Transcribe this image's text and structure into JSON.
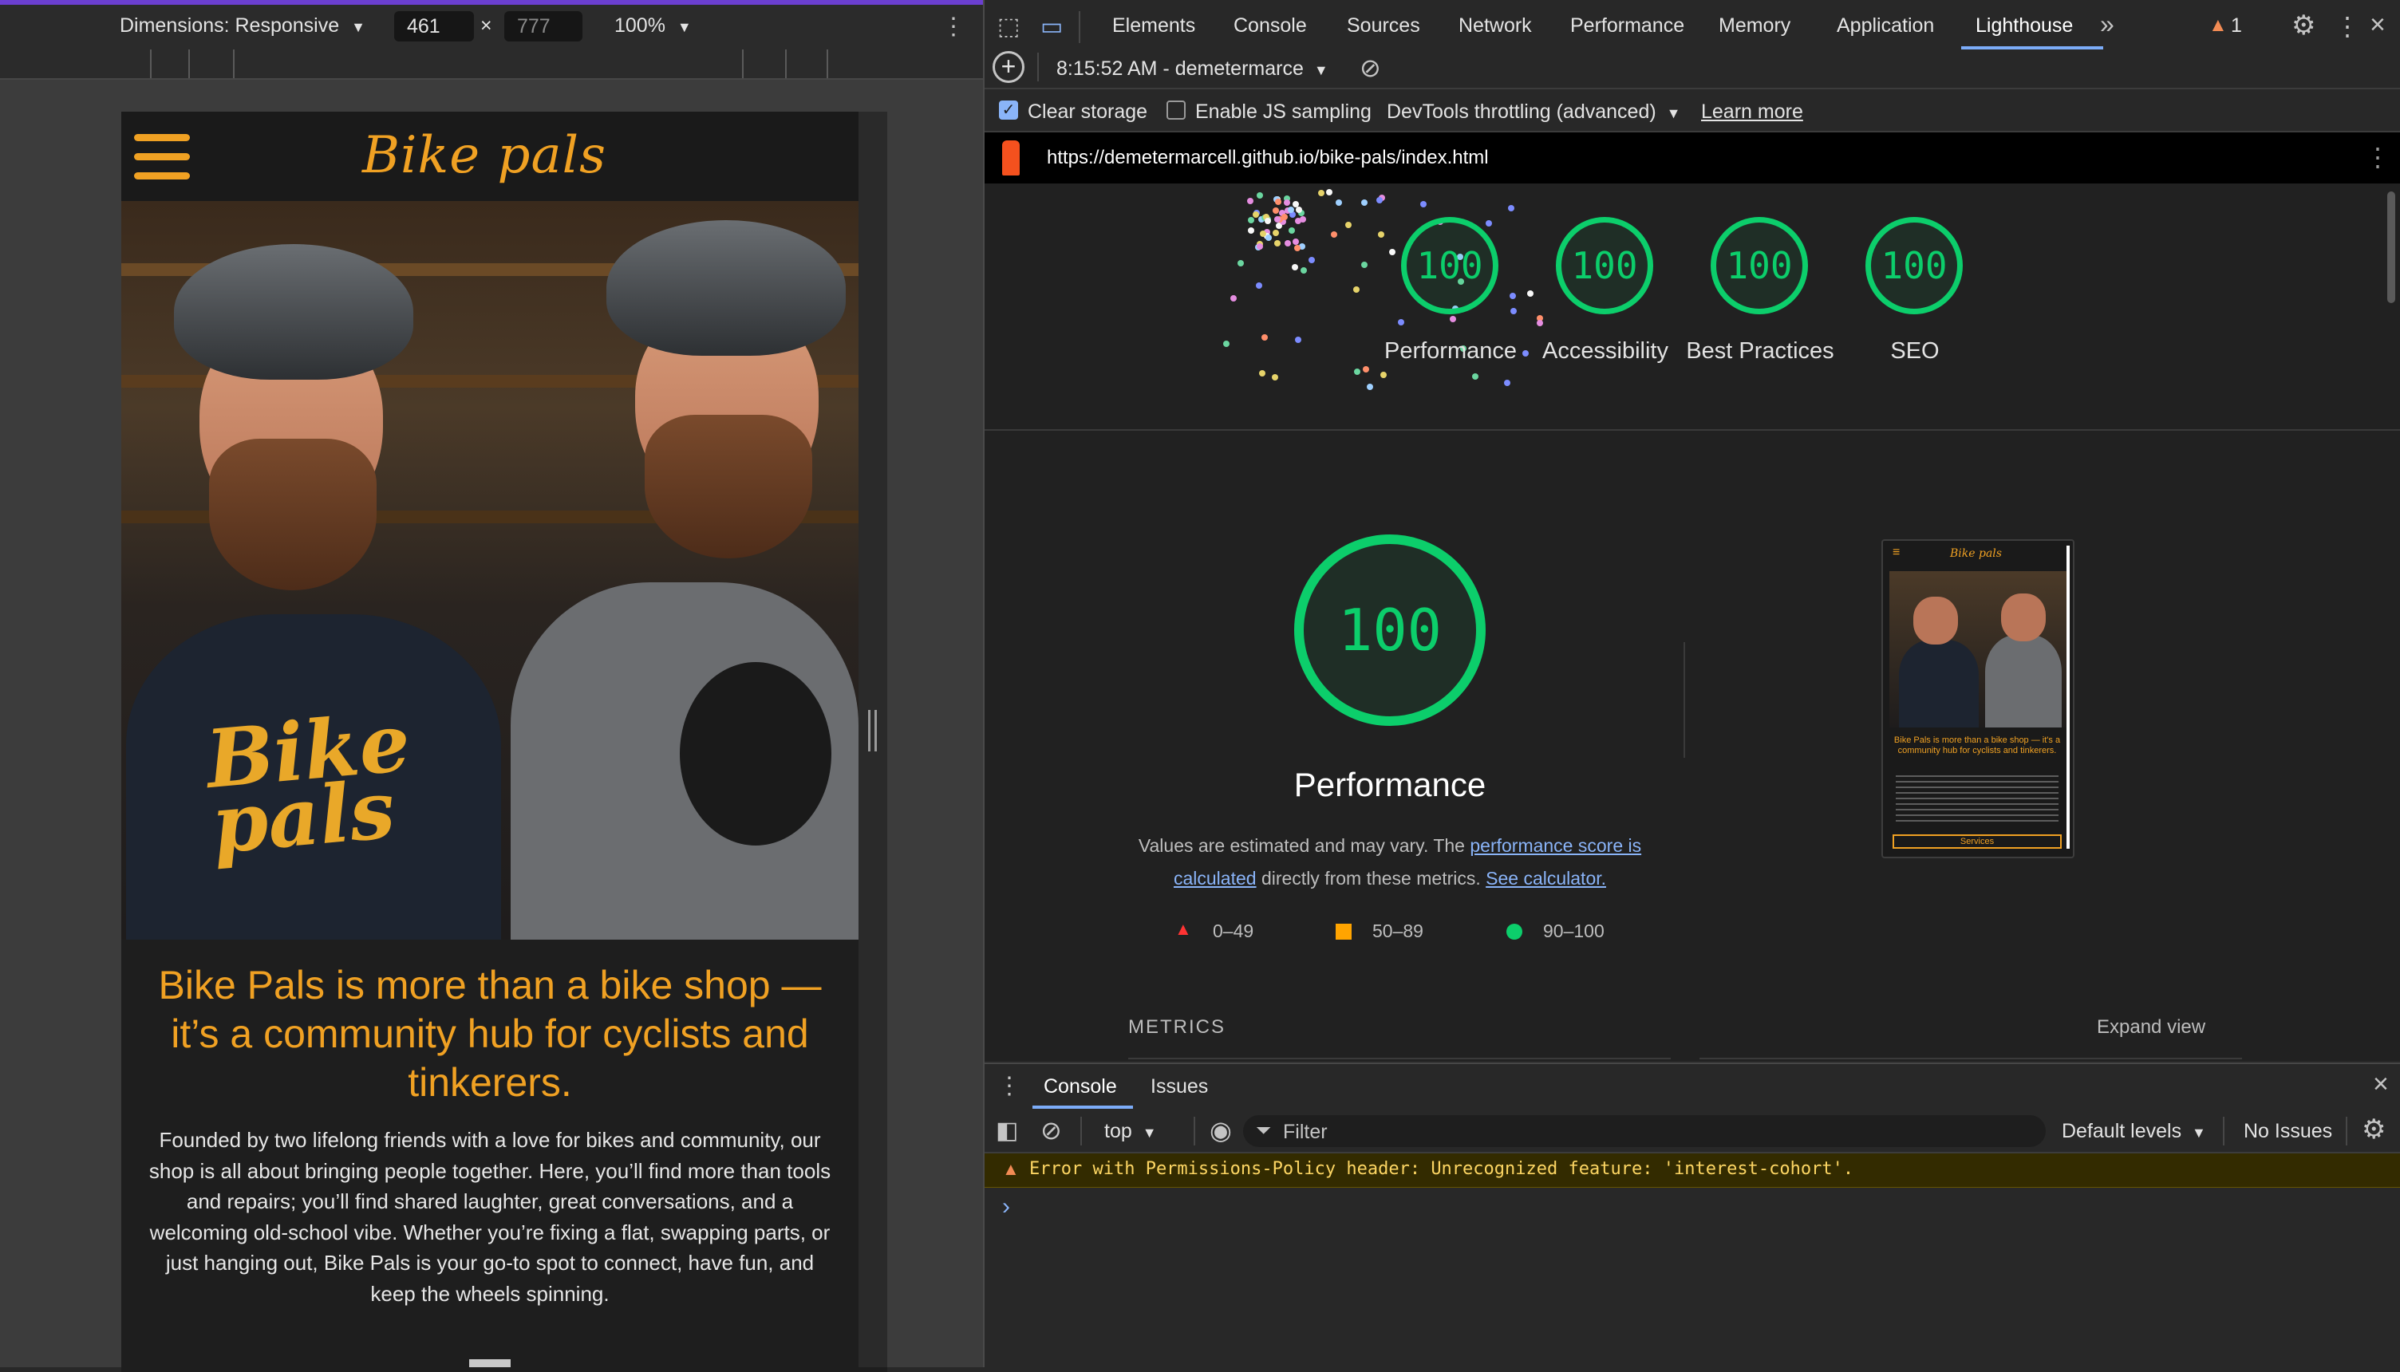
{
  "device_toolbar": {
    "dimensions_label": "Dimensions: Responsive",
    "width_value": "461",
    "times": "×",
    "height_placeholder": "777",
    "zoom_label": "100%"
  },
  "site": {
    "logo_text": "Bike pals",
    "shirt_print_line1": "Bike",
    "shirt_print_line2": "pals",
    "heading": "Bike Pals is more than a bike shop — it’s a community hub for cyclists and tinkerers.",
    "paragraph": "Founded by two lifelong friends with a love for bikes and community, our shop is all about bringing people together. Here, you’ll find more than tools and repairs; you’ll find shared laughter, great conversations, and a welcoming old-school vibe. Whether you’re fixing a flat, swapping parts, or just hanging out, Bike Pals is your go-to spot to connect, have fun, and keep the wheels spinning."
  },
  "devtools": {
    "tabs": [
      "Elements",
      "Console",
      "Sources",
      "Network",
      "Performance",
      "Memory",
      "Application",
      "Lighthouse"
    ],
    "active_tab": "Lighthouse",
    "more_tabs": "»",
    "warnings_count": "1"
  },
  "lighthouse": {
    "report_selector": "8:15:52 AM - demetermarce",
    "clear_storage_label": "Clear storage",
    "clear_storage_checked": true,
    "js_sampling_label": "Enable JS sampling",
    "js_sampling_checked": false,
    "throttling_label": "DevTools throttling (advanced)",
    "learn_more": "Learn more",
    "url": "https://demetermarcell.github.io/bike-pals/index.html",
    "scores": [
      {
        "label": "Performance",
        "value": "100"
      },
      {
        "label": "Accessibility",
        "value": "100"
      },
      {
        "label": "Best Practices",
        "value": "100"
      },
      {
        "label": "SEO",
        "value": "100"
      }
    ],
    "performance": {
      "score": "100",
      "title": "Performance",
      "note_prefix": "Values are estimated and may vary. The ",
      "note_link1": "performance score is calculated",
      "note_middle": " directly from these metrics. ",
      "note_link2": "See calculator."
    },
    "legend": [
      {
        "range": "0–49",
        "color": "#ff3333"
      },
      {
        "range": "50–89",
        "color": "#ffa400"
      },
      {
        "range": "90–100",
        "color": "#0cce6b"
      }
    ],
    "metrics_header": "METRICS",
    "expand_view": "Expand view",
    "thumbnail": {
      "logo": "Bike pals",
      "heading": "Bike Pals is more than a bike shop — it's a community hub for cyclists and tinkerers.",
      "button": "Services"
    }
  },
  "drawer": {
    "tabs": [
      "Console",
      "Issues"
    ],
    "active_tab": "Console",
    "context": "top",
    "filter_placeholder": "Filter",
    "levels": "Default levels",
    "issues": "No Issues",
    "error_message": "Error with Permissions-Policy header: Unrecognized feature: 'interest-cohort'.",
    "prompt": "›"
  },
  "colors": {
    "accent_orange": "#f0a123",
    "score_green": "#0cce6b",
    "devtools_active_tab": "#7cacf8",
    "warning_yellow": "#fdd663"
  }
}
